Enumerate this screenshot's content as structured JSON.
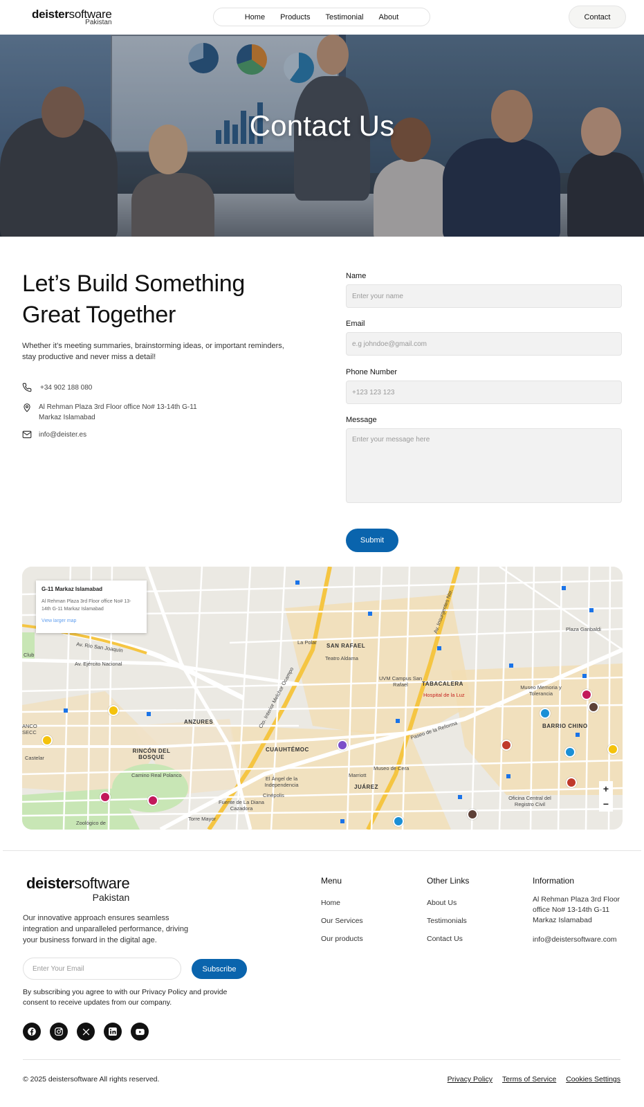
{
  "header": {
    "logo_bold": "deister",
    "logo_light": "software",
    "logo_sub": "Pakistan",
    "nav": [
      "Home",
      "Products",
      "Testimonial",
      "About"
    ],
    "contact_button": "Contact"
  },
  "hero": {
    "title": "Contact Us"
  },
  "contact": {
    "headline": "Let’s Build Something Great Together",
    "intro": "Whether it’s meeting summaries, brainstorming ideas, or important reminders, stay productive and never miss a detail!",
    "phone": "+34 902 188 080",
    "address": "Al Rehman Plaza 3rd Floor office No# 13-14th G-11 Markaz Islamabad",
    "email": "info@deister.es"
  },
  "form": {
    "name_label": "Name",
    "name_placeholder": "Enter your name",
    "email_label": "Email",
    "email_placeholder": "e.g johndoe@gmail.com",
    "phone_label": "Phone Number",
    "phone_placeholder": "+123 123 123",
    "message_label": "Message",
    "message_placeholder": "Enter your message here",
    "submit_label": "Submit"
  },
  "map": {
    "card_title": "G-11 Markaz Islamabad",
    "card_address": "Al Rehman Plaza 3rd Floor office No# 13-14th G-11 Markaz Islamabad",
    "card_link": "View larger map",
    "zoom_in": "+",
    "zoom_out": "−",
    "labels": {
      "san_rafael": "SAN RAFAEL",
      "tabacalera": "TABACALERA",
      "anzures": "ANZURES",
      "cuauhtemoc": "CUAUHTÉMOC",
      "juarez": "JUÁREZ",
      "barrio_chino": "BARRIO CHINO",
      "rincon": "RINCÓN DEL BOSQUE",
      "la_polar": "La Polar",
      "teatro": "Teatro Aldama",
      "uvm": "UVM Campus San Rafael",
      "hospital": "Hospital de la Luz",
      "museo_memoria": "Museo Memoria y Tolerancia",
      "plaza_garibaldi": "Plaza Garibaldi",
      "museo_cera": "Museo de Cera",
      "marriott": "Marriott",
      "angel": "El Ángel de la Independencia",
      "cinepolis": "Cinépolis",
      "fuente": "Fuente de La Diana Cazadora",
      "torre_mayor": "Torre Mayor",
      "camino_real": "Camino Real Polanco",
      "zoologico": "Zoológico de",
      "oficina": "Oficina Central del Registro Civil",
      "rio_san_joaquin": "Av. Río San Joaquín",
      "ejercito": "Av. Ejército Nacional",
      "insurgentes": "Av. Insurgentes Nte.",
      "reforma": "Paseo de la Reforma",
      "circuito": "Cto. Interior Melchor Ocampo",
      "club": "Club",
      "castelar": "Castelar",
      "anco": "ANCO SECC"
    }
  },
  "footer": {
    "logo_bold": "deister",
    "logo_light": "software",
    "logo_sub": "Pakistan",
    "description": "Our innovative approach ensures seamless integration and unparalleled performance, driving your business forward in the digital age.",
    "email_placeholder": "Enter Your Email",
    "subscribe_label": "Subscribe",
    "consent": "By subscribing you agree to with our Privacy Policy and provide consent to receive updates from our company.",
    "menu_title": "Menu",
    "menu_links": [
      "Home",
      "Our Services",
      "Our products"
    ],
    "other_title": "Other Links",
    "other_links": [
      "About Us",
      "Testimonials",
      "Contact Us"
    ],
    "info_title": "Information",
    "info_address": "Al Rehman Plaza 3rd Floor office No# 13-14th G-11 Markaz Islamabad",
    "info_email": "info@deistersoftware.com",
    "copyright": "© 2025 deistersoftware All rights reserved.",
    "legal_links": [
      "Privacy Policy",
      "Terms of Service",
      "Cookies Settings"
    ]
  },
  "colors": {
    "accent": "#0a64ad",
    "social_bg": "#111111"
  },
  "icons": [
    "phone-icon",
    "location-icon",
    "mail-icon",
    "facebook-icon",
    "instagram-icon",
    "x-icon",
    "linkedin-icon",
    "youtube-icon"
  ]
}
